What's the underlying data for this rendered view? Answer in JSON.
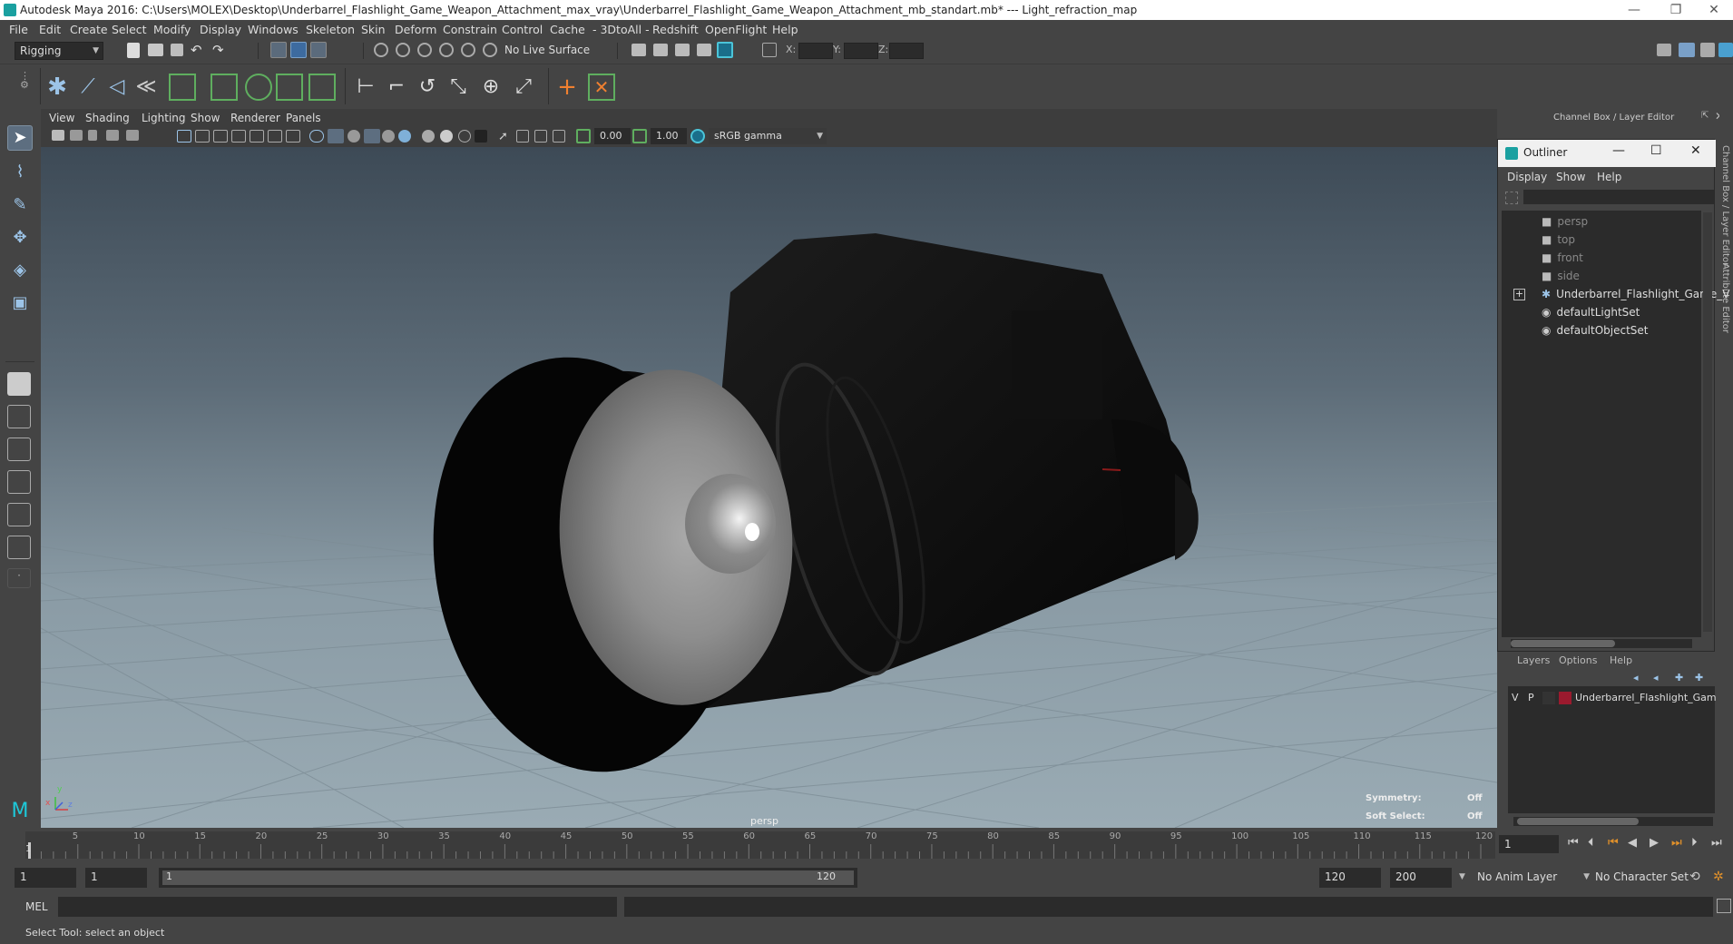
{
  "window": {
    "title": "Autodesk Maya 2016: C:\\Users\\MOLEX\\Desktop\\Underbarrel_Flashlight_Game_Weapon_Attachment_max_vray\\Underbarrel_Flashlight_Game_Weapon_Attachment_mb_standart.mb*  ---  Light_refraction_map",
    "controls": {
      "minimize": "—",
      "maximize": "❐",
      "close": "✕"
    }
  },
  "menubar": [
    "File",
    "Edit",
    "Create",
    "Select",
    "Modify",
    "Display",
    "Windows",
    "Skeleton",
    "Skin",
    "Deform",
    "Constrain",
    "Control",
    "Cache",
    "- 3DtoAll -",
    "Redshift",
    "OpenFlight",
    "Help"
  ],
  "statusline": {
    "menu_set": "Rigging",
    "live_surface": "No Live Surface",
    "coord_labels": {
      "x": "X:",
      "y": "Y:",
      "z": "Z:"
    }
  },
  "viewport": {
    "menu": [
      "View",
      "Shading",
      "Lighting",
      "Show",
      "Renderer",
      "Panels"
    ],
    "exposure": "0.00",
    "gamma": "1.00",
    "colorspace": "sRGB gamma",
    "camera_label": "persp",
    "hud": {
      "symmetry_label": "Symmetry:",
      "symmetry_value": "Off",
      "soft_select_label": "Soft Select:",
      "soft_select_value": "Off"
    },
    "axis": {
      "x": "x",
      "y": "y",
      "z": "z"
    }
  },
  "channelbox_header": "Channel Box / Layer Editor",
  "side_tabs": [
    "Channel Box / Layer Editor",
    "Attribute Editor"
  ],
  "outliner": {
    "title": "Outliner",
    "menu": [
      "Display",
      "Show",
      "Help"
    ],
    "items": [
      {
        "label": "persp",
        "icon": "camera-icon",
        "dim": true
      },
      {
        "label": "top",
        "icon": "camera-icon",
        "dim": true
      },
      {
        "label": "front",
        "icon": "camera-icon",
        "dim": true
      },
      {
        "label": "side",
        "icon": "camera-icon",
        "dim": true
      },
      {
        "label": "Underbarrel_Flashlight_Game_V",
        "icon": "joint-icon",
        "dim": false,
        "expandable": true
      },
      {
        "label": "defaultLightSet",
        "icon": "set-icon",
        "dim": false
      },
      {
        "label": "defaultObjectSet",
        "icon": "set-icon",
        "dim": false
      }
    ]
  },
  "layers": {
    "menu": [
      "Layers",
      "Options",
      "Help"
    ],
    "rows": [
      {
        "v": "V",
        "p": "P",
        "color": "#9b1a2e",
        "name": "Underbarrel_Flashlight_Gam"
      }
    ]
  },
  "timeline": {
    "ticks": [
      "5",
      "10",
      "15",
      "20",
      "25",
      "30",
      "35",
      "40",
      "45",
      "50",
      "55",
      "60",
      "65",
      "70",
      "75",
      "80",
      "85",
      "90",
      "95",
      "100",
      "105",
      "110",
      "115",
      "120"
    ],
    "start_tick": "1",
    "current_frame": "1"
  },
  "rangebar": {
    "start": "1",
    "anim_start": "1",
    "slider_start": "1",
    "slider_end": "120",
    "anim_end": "120",
    "end": "200",
    "anim_layer": "No Anim Layer",
    "char_set": "No Character Set"
  },
  "cmdline": {
    "label": "MEL"
  },
  "helpline": {
    "text": "Select Tool: select an object"
  }
}
